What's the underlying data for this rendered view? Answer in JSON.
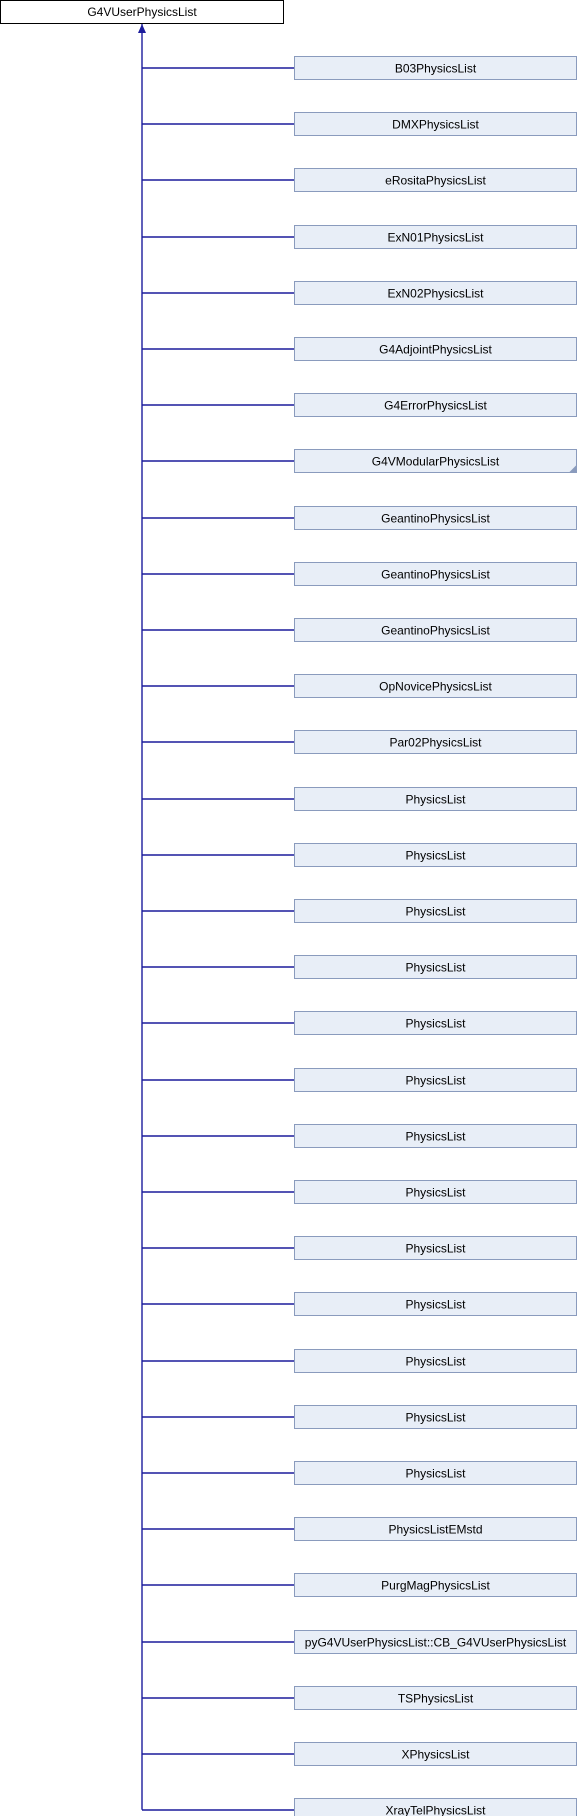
{
  "base_class": "G4VUserPhysicsList",
  "derived_classes": [
    {
      "name": "B03PhysicsList"
    },
    {
      "name": "DMXPhysicsList"
    },
    {
      "name": "eRositaPhysicsList"
    },
    {
      "name": "ExN01PhysicsList"
    },
    {
      "name": "ExN02PhysicsList"
    },
    {
      "name": "G4AdjointPhysicsList"
    },
    {
      "name": "G4ErrorPhysicsList"
    },
    {
      "name": "G4VModularPhysicsList",
      "has_more": true
    },
    {
      "name": "GeantinoPhysicsList"
    },
    {
      "name": "GeantinoPhysicsList"
    },
    {
      "name": "GeantinoPhysicsList"
    },
    {
      "name": "OpNovicePhysicsList"
    },
    {
      "name": "Par02PhysicsList"
    },
    {
      "name": "PhysicsList"
    },
    {
      "name": "PhysicsList"
    },
    {
      "name": "PhysicsList"
    },
    {
      "name": "PhysicsList"
    },
    {
      "name": "PhysicsList"
    },
    {
      "name": "PhysicsList"
    },
    {
      "name": "PhysicsList"
    },
    {
      "name": "PhysicsList"
    },
    {
      "name": "PhysicsList"
    },
    {
      "name": "PhysicsList"
    },
    {
      "name": "PhysicsList"
    },
    {
      "name": "PhysicsList"
    },
    {
      "name": "PhysicsList"
    },
    {
      "name": "PhysicsListEMstd"
    },
    {
      "name": "PurgMagPhysicsList"
    },
    {
      "name": "pyG4VUserPhysicsList::CB_G4VUserPhysicsList"
    },
    {
      "name": "TSPhysicsList"
    },
    {
      "name": "XPhysicsList"
    },
    {
      "name": "XrayTelPhysicsList"
    }
  ],
  "colors": {
    "edge": "#1c1c9c",
    "child_fill": "#e8eef7",
    "child_border": "#8a9bbd",
    "root_fill": "#ffffff",
    "root_border": "#000000"
  }
}
